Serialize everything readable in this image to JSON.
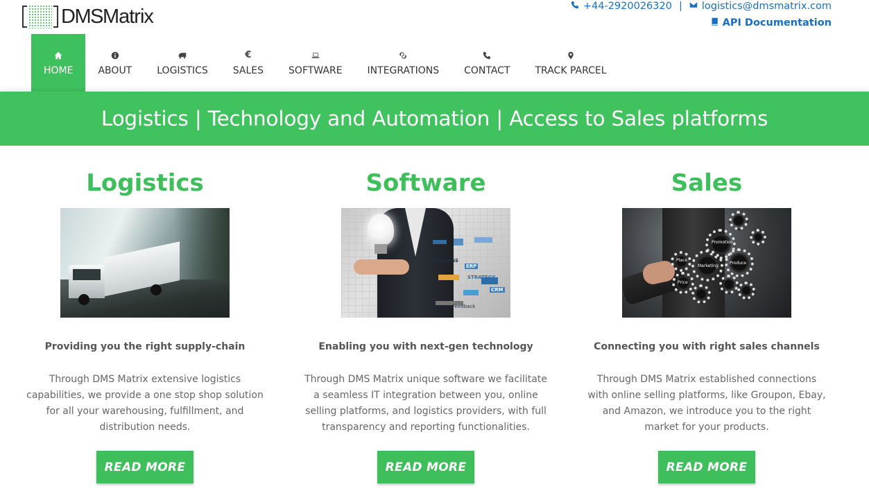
{
  "logo": {
    "brand_bold": "DMS",
    "brand_rest": "Matrix"
  },
  "topbar": {
    "phone": "+44-2920026320",
    "separator": "|",
    "email": "logistics@dmsmatrix.com",
    "api_link": "API Documentation"
  },
  "nav": {
    "items": [
      {
        "label": "HOME",
        "icon": "home-icon",
        "active": true
      },
      {
        "label": "ABOUT",
        "icon": "info-icon"
      },
      {
        "label": "LOGISTICS",
        "icon": "truck-icon"
      },
      {
        "label": "SALES",
        "icon": "euro-icon"
      },
      {
        "label": "SOFTWARE",
        "icon": "laptop-icon"
      },
      {
        "label": "INTEGRATIONS",
        "icon": "link-icon"
      },
      {
        "label": "CONTACT",
        "icon": "phone-icon"
      },
      {
        "label": "TRACK PARCEL",
        "icon": "map-marker-icon"
      }
    ]
  },
  "banner": {
    "title": "Logistics | Technology and Automation | Access to Sales platforms"
  },
  "columns": [
    {
      "title": "Logistics",
      "subtitle": "Providing you the right supply-chain",
      "body": "Through DMS Matrix extensive logistics capabilities, we provide a one stop shop solution for all your warehousing, fulfillment, and distribution needs.",
      "button": "READ MORE"
    },
    {
      "title": "Software",
      "subtitle": "Enabling you with next-gen technology",
      "body": "Through DMS Matrix unique software we facilitate a seamless IT integration between you, online selling platforms, and logistics providers, with full transparency and reporting functionalities.",
      "button": "READ MORE",
      "image_words": {
        "business": "BUSINESS",
        "strategy": "STRATEGY",
        "erp": "ERP",
        "crm": "CRM",
        "feedback": "Feedback"
      }
    },
    {
      "title": "Sales",
      "subtitle": "Connecting you with right sales channels",
      "body": "Through DMS Matrix established connections with online selling platforms, like Groupon, Ebay, and Amazon, we introduce you to the right market for your products.",
      "button": "READ MORE",
      "image_words": {
        "promotion": "Promotion",
        "marketing": "Marketing",
        "produce": "Produce",
        "place": "Place",
        "price": "Price"
      }
    }
  ],
  "colors": {
    "accent": "#40c25e",
    "link": "#1a6fc4"
  }
}
